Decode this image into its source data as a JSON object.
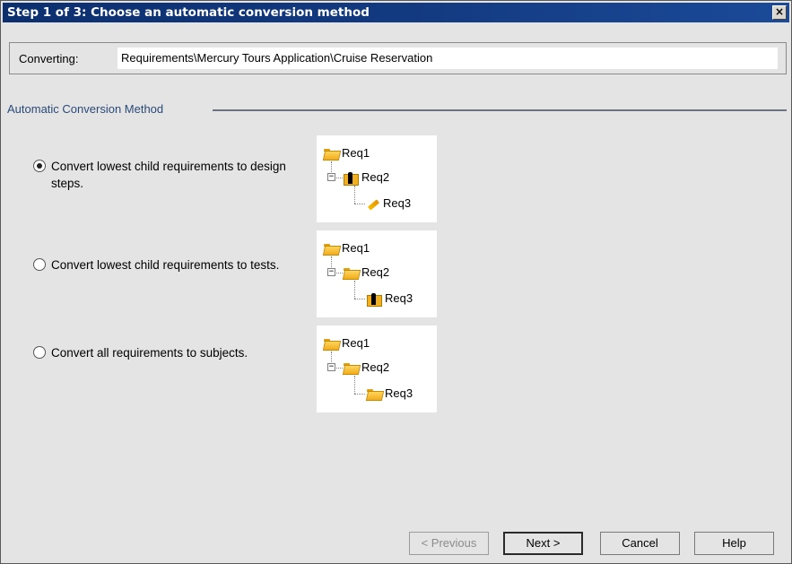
{
  "window": {
    "title": "Step 1 of 3: Choose an automatic conversion method",
    "close_glyph": "×"
  },
  "converting": {
    "label": "Converting:",
    "value": "Requirements\\Mercury Tours Application\\Cruise Reservation"
  },
  "group": {
    "legend": "Automatic Conversion Method"
  },
  "options": [
    {
      "text": "Convert lowest child requirements to design steps.",
      "selected": true,
      "tree": [
        {
          "label": "Req1",
          "icon": "folder-open-icon"
        },
        {
          "label": "Req2",
          "icon": "test-figure-icon"
        },
        {
          "label": "Req3",
          "icon": "design-step-pencil-icon"
        }
      ]
    },
    {
      "text": "Convert lowest child requirements to tests.",
      "selected": false,
      "tree": [
        {
          "label": "Req1",
          "icon": "folder-open-icon"
        },
        {
          "label": "Req2",
          "icon": "folder-open-icon"
        },
        {
          "label": "Req3",
          "icon": "test-figure-icon"
        }
      ]
    },
    {
      "text": "Convert all requirements to subjects.",
      "selected": false,
      "tree": [
        {
          "label": "Req1",
          "icon": "folder-open-icon"
        },
        {
          "label": "Req2",
          "icon": "folder-open-icon"
        },
        {
          "label": "Req3",
          "icon": "folder-open-icon"
        }
      ]
    }
  ],
  "tree_expander_glyph": "−",
  "buttons": {
    "previous": "< Previous",
    "next": "Next >",
    "cancel": "Cancel",
    "help": "Help"
  },
  "colors": {
    "title_bar": "#133b82",
    "legend_text": "#2a4a78",
    "folder": "#f2ac1a"
  }
}
